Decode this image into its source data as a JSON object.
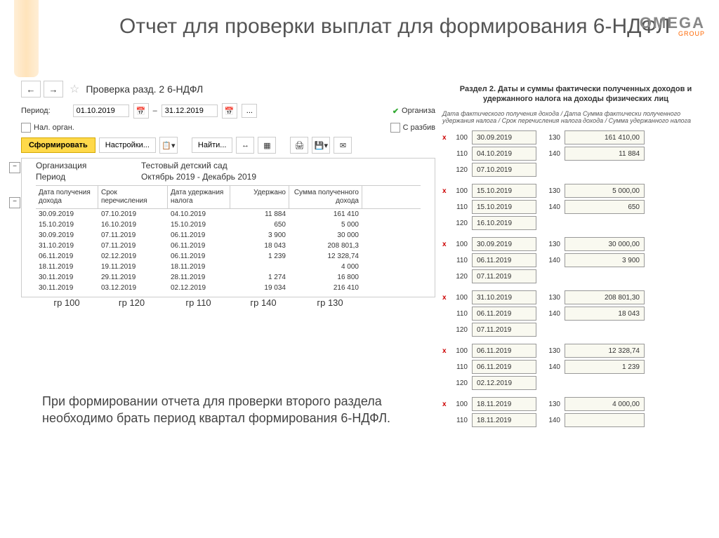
{
  "slide": {
    "title": "Отчет для проверки выплат для формирования 6-НДФЛ",
    "note": "При формировании отчета для проверки второго раздела необходимо брать период квартал формирования 6-НДФЛ.",
    "logo_main": "OMEGA",
    "logo_sub": "GROUP"
  },
  "app": {
    "window_title": "Проверка разд. 2 6-НДФЛ",
    "period_label": "Период:",
    "date_from": "01.10.2019",
    "date_to": "31.12.2019",
    "dash": "–",
    "chk_org": "Организа",
    "chk_nalog": "Нал. орган.",
    "chk_razbiv": "С разбив",
    "btn_form": "Сформировать",
    "btn_settings": "Настройки...",
    "btn_find": "Найти...",
    "org_label": "Организация",
    "org_value": "Тестовый детский сад",
    "period_label2": "Период",
    "period_value": "Октябрь 2019 - Декабрь 2019",
    "headers": {
      "c1": "Дата получения дохода",
      "c2": "Срок перечисления",
      "c3": "Дата удержания налога",
      "c4": "Удержано",
      "c5": "Сумма полученного дохода"
    },
    "rows": [
      {
        "c1": "30.09.2019",
        "c2": "07.10.2019",
        "c3": "04.10.2019",
        "c4": "11 884",
        "c5": "161 410"
      },
      {
        "c1": "15.10.2019",
        "c2": "16.10.2019",
        "c3": "15.10.2019",
        "c4": "650",
        "c5": "5 000"
      },
      {
        "c1": "30.09.2019",
        "c2": "07.11.2019",
        "c3": "06.11.2019",
        "c4": "3 900",
        "c5": "30 000"
      },
      {
        "c1": "31.10.2019",
        "c2": "07.11.2019",
        "c3": "06.11.2019",
        "c4": "18 043",
        "c5": "208 801,3"
      },
      {
        "c1": "06.11.2019",
        "c2": "02.12.2019",
        "c3": "06.11.2019",
        "c4": "1 239",
        "c5": "12 328,74"
      },
      {
        "c1": "18.11.2019",
        "c2": "19.11.2019",
        "c3": "18.11.2019",
        "c4": "",
        "c5": "4 000"
      },
      {
        "c1": "30.11.2019",
        "c2": "29.11.2019",
        "c3": "28.11.2019",
        "c4": "1 274",
        "c5": "16 800"
      },
      {
        "c1": "30.11.2019",
        "c2": "03.12.2019",
        "c3": "02.12.2019",
        "c4": "19 034",
        "c5": "216 410"
      }
    ],
    "col_labels": {
      "c1": "гр 100",
      "c2": "гр 120",
      "c3": "гр 110",
      "c4": "гр 140",
      "c5": "гр 130"
    }
  },
  "section2": {
    "title": "Раздел 2. Даты и суммы фактически полученных доходов и удержанного налога на доходы физических лиц",
    "hdr_left": "Дата фактического получения дохода / Дата удержания налога / Срок перечисления налога",
    "hdr_right": "Сумма фактически полученного дохода / Сумма удержанного налога",
    "blocks": [
      {
        "r100": "30.09.2019",
        "r110": "04.10.2019",
        "r120": "07.10.2019",
        "r130": "161 410,00",
        "r140": "11 884"
      },
      {
        "r100": "15.10.2019",
        "r110": "15.10.2019",
        "r120": "16.10.2019",
        "r130": "5 000,00",
        "r140": "650"
      },
      {
        "r100": "30.09.2019",
        "r110": "06.11.2019",
        "r120": "07.11.2019",
        "r130": "30 000,00",
        "r140": "3 900"
      },
      {
        "r100": "31.10.2019",
        "r110": "06.11.2019",
        "r120": "07.11.2019",
        "r130": "208 801,30",
        "r140": "18 043"
      },
      {
        "r100": "06.11.2019",
        "r110": "06.11.2019",
        "r120": "02.12.2019",
        "r130": "12 328,74",
        "r140": "1 239"
      },
      {
        "r100": "18.11.2019",
        "r110": "18.11.2019",
        "r120": "",
        "r130": "4 000,00",
        "r140": ""
      }
    ]
  }
}
